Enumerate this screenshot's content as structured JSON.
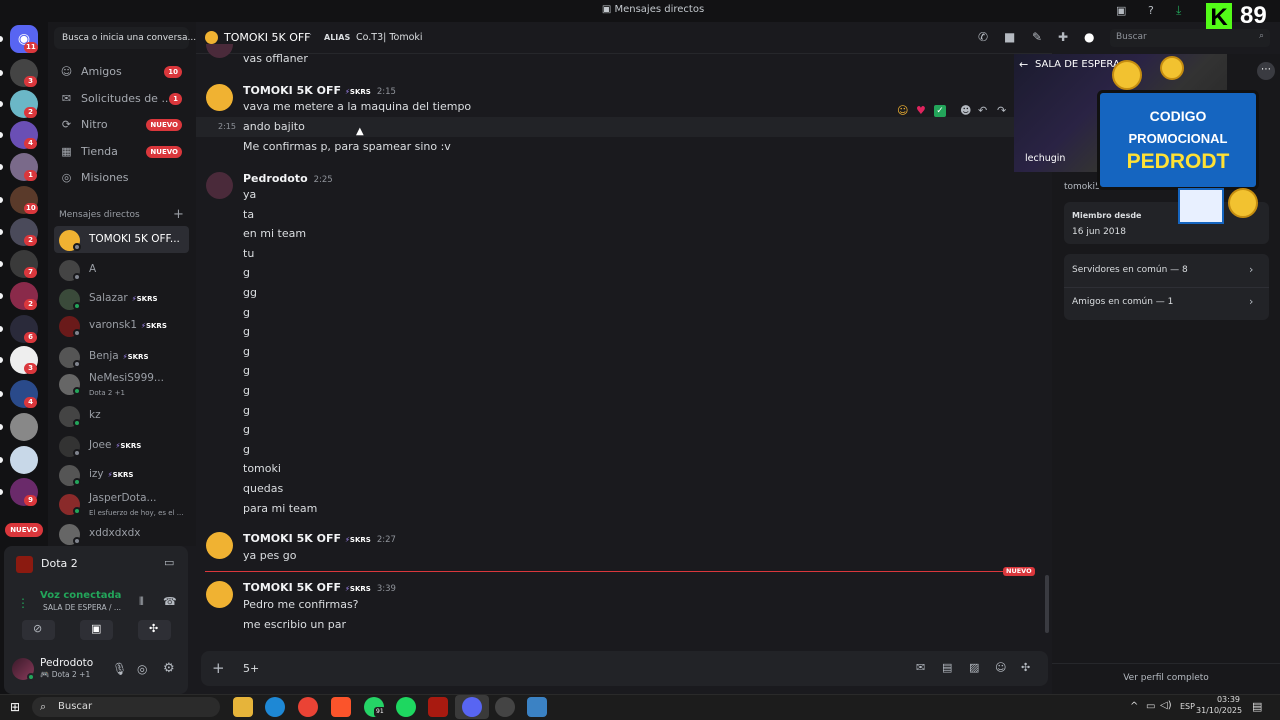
{
  "window": {
    "title": "Mensajes directos",
    "streamer_count": "89"
  },
  "servers": [
    {
      "badge": "11"
    },
    {
      "badge": "3"
    },
    {
      "badge": "2"
    },
    {
      "badge": "4"
    },
    {
      "badge": "1"
    },
    {
      "badge": "10"
    },
    {
      "badge": "2"
    },
    {
      "badge": "7"
    },
    {
      "badge": "2"
    },
    {
      "badge": "6"
    },
    {
      "badge": "3"
    },
    {
      "badge": "4"
    },
    {
      "badge": ""
    },
    {
      "badge": ""
    },
    {
      "badge": "9"
    }
  ],
  "servers_new_label": "NUEVO",
  "sidebar": {
    "search_placeholder": "Busca o inicia una conversa...",
    "nav": [
      {
        "label": "Amigos",
        "badge": "10"
      },
      {
        "label": "Solicitudes de ...",
        "badge": "1"
      },
      {
        "label": "Nitro",
        "badge": "NUEVO"
      },
      {
        "label": "Tienda",
        "badge": "NUEVO"
      },
      {
        "label": "Misiones",
        "badge": ""
      }
    ],
    "dm_header": "Mensajes directos",
    "dms": [
      {
        "name": "TOMOKI 5K OFF...",
        "sub": "",
        "tag": ""
      },
      {
        "name": "A",
        "sub": "",
        "tag": ""
      },
      {
        "name": "Salazar",
        "sub": "",
        "tag": "SKRS"
      },
      {
        "name": "varonsk1",
        "sub": "",
        "tag": "SKRS"
      },
      {
        "name": "Benja",
        "sub": "",
        "tag": "SKRS"
      },
      {
        "name": "NeMesiS999...",
        "sub": "Dota 2 +1",
        "tag": ""
      },
      {
        "name": "kz",
        "sub": "",
        "tag": ""
      },
      {
        "name": "Joee",
        "sub": "",
        "tag": "SKRS"
      },
      {
        "name": "izy",
        "sub": "",
        "tag": "SKRS"
      },
      {
        "name": "JasperDota...",
        "sub": "El esfuerzo de hoy, es el ...",
        "tag": ""
      },
      {
        "name": "xddxdxdx",
        "sub": "",
        "tag": ""
      }
    ]
  },
  "activity": {
    "game": "Dota 2",
    "voice_status": "Voz conectada",
    "voice_channel": "SALA DE ESPERA / ...",
    "user": "Pedrodoto",
    "user_status": "Dota 2 +1"
  },
  "header": {
    "name": "TOMOKI 5K OFF",
    "alias_label": "ALIAS",
    "alias": "Co.T3| Tomoki",
    "search_placeholder": "Buscar"
  },
  "messages": {
    "prev_line": "vas offlaner",
    "g1": {
      "author": "TOMOKI 5K OFF",
      "tag": "SKRS",
      "time": "2:15",
      "lines": [
        "vava me metere a la maquina del tiempo",
        "ando bajito",
        "Me confirmas p, para spamear sino :v"
      ],
      "hover_time": "2:15"
    },
    "g2": {
      "author": "Pedrodoto",
      "time": "2:25",
      "lines": [
        "ya",
        "ta",
        "en mi team",
        "tu",
        "g",
        "gg",
        "g",
        "g",
        "g",
        "g",
        "g",
        "g",
        "g",
        "g",
        "tomoki",
        "quedas",
        "para mi team"
      ]
    },
    "g3": {
      "author": "TOMOKI 5K OFF",
      "tag": "SKRS",
      "time": "2:27",
      "lines": [
        "ya pes go"
      ]
    },
    "new_label": "NUEVO",
    "g4": {
      "author": "TOMOKI 5K OFF",
      "tag": "SKRS",
      "time": "3:39",
      "lines": [
        "Pedro me confirmas?",
        "me escribio un par"
      ]
    }
  },
  "input": {
    "counter": "5+"
  },
  "profile": {
    "stream_title": "SALA DE ESPERA",
    "stream_user": "lechugin",
    "username": "tomoki58",
    "member_since_label": "Miembro desde",
    "member_since": "16 jun 2018",
    "mutual_servers": "Servidores en común — 8",
    "mutual_friends": "Amigos en común — 1",
    "full_profile": "Ver perfil completo"
  },
  "promo": {
    "line1": "CODIGO",
    "line2": "PROMOCIONAL",
    "line3": "PEDRODT"
  },
  "taskbar": {
    "search": "Buscar",
    "whatsapp_badge": "91",
    "lang": "ESP",
    "time": "03:39",
    "date": "31/10/2025"
  },
  "colors": {
    "accent": "#5865f2",
    "danger": "#da373c",
    "online": "#23a55a",
    "promo": "#1565c0",
    "promo_text": "#ffe135"
  }
}
